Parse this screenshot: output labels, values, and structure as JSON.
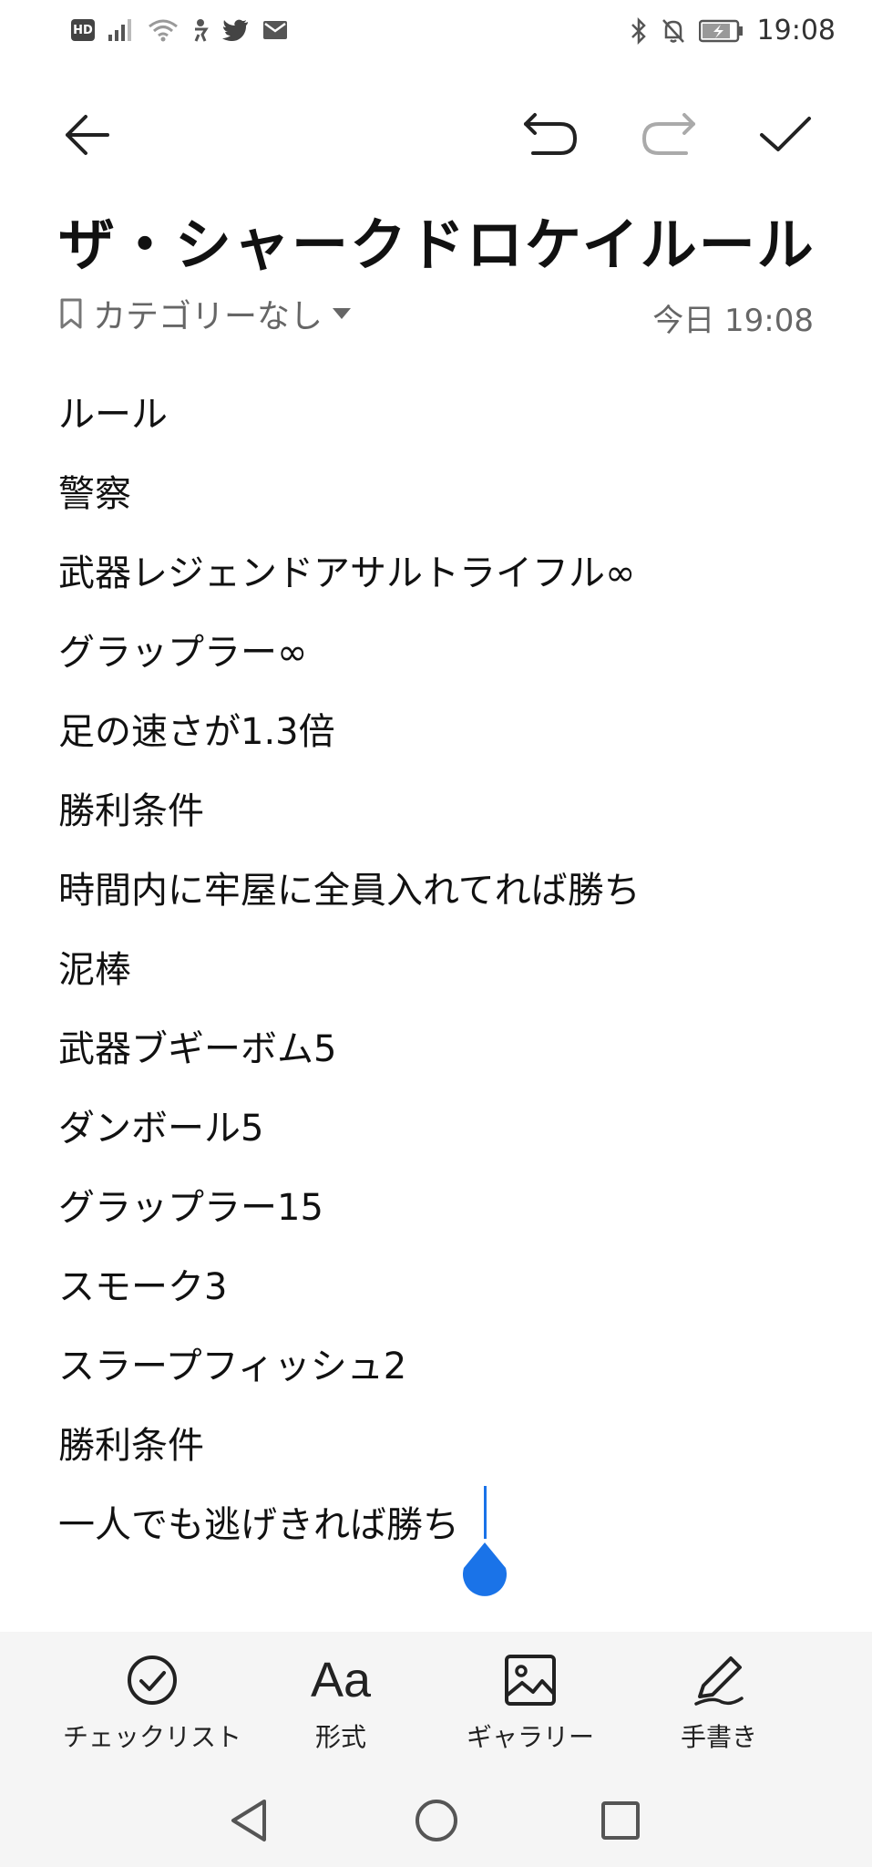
{
  "status": {
    "left_icons": [
      "hd-icon",
      "signal-icon",
      "wifi-icon",
      "fitness-icon",
      "twitter-icon",
      "mail-icon"
    ],
    "hd_label": "HD",
    "time": "19:08"
  },
  "toolbar": {
    "back_icon": "arrow-left-icon",
    "undo_icon": "undo-icon",
    "redo_icon": "redo-icon",
    "confirm_icon": "check-icon"
  },
  "note": {
    "title": "ザ・シャークドロケイルール",
    "category": "カテゴリーなし",
    "date": "今日 19:08",
    "lines": [
      "ルール",
      "警察",
      "武器レジェンドアサルトライフル∞",
      "グラップラー∞",
      "足の速さが1.3倍",
      "勝利条件",
      "時間内に牢屋に全員入れてれば勝ち",
      "泥棒",
      "武器ブギーボム5",
      "ダンボール5",
      "グラップラー15",
      "スモーク3",
      "スラープフィッシュ2",
      "勝利条件",
      "一人でも逃げきれば勝ち"
    ]
  },
  "tools": {
    "checklist": "チェックリスト",
    "format_icon_text": "Aa",
    "format": "形式",
    "gallery": "ギャラリー",
    "handwriting": "手書き"
  },
  "colors": {
    "accent": "#1a73e8",
    "panel": "#f5f5f5"
  }
}
